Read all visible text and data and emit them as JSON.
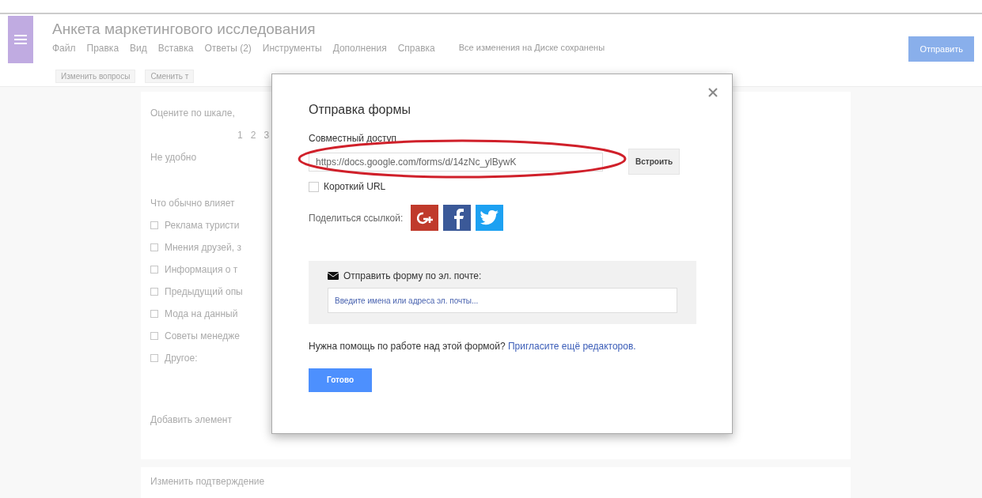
{
  "app": {
    "title": "Анкета маркетингового исследования",
    "menu": [
      "Файл",
      "Правка",
      "Вид",
      "Вставка",
      "Ответы (2)",
      "Инструменты",
      "Дополнения",
      "Справка"
    ],
    "save_status": "Все изменения на Диске сохранены",
    "send_button": "Отправить",
    "toolbar": [
      "Изменить вопросы",
      "Сменить т"
    ]
  },
  "form": {
    "scale_question": "Оцените по шкале,",
    "scale_numbers": [
      "1",
      "2",
      "3"
    ],
    "scale_low": "Не удобно",
    "question": "Что обычно влияет",
    "options": [
      {
        "label": "Реклама туристи",
        "checked": false
      },
      {
        "label": "Мнения друзей, з",
        "checked": false
      },
      {
        "label": "Информация о т",
        "checked": false
      },
      {
        "label": "Предыдущий опы",
        "checked": false
      },
      {
        "label": "Мода на данный",
        "checked": false
      },
      {
        "label": "Советы менедже",
        "checked": false
      },
      {
        "label": "Другое:",
        "checked": false
      }
    ],
    "add_item": "Добавить элемент",
    "confirmation": "Изменить подтверждение"
  },
  "dialog": {
    "title": "Отправка формы",
    "share_label": "Совместный доступ",
    "url": "https://docs.google.com/forms/d/14zNc_ylBywK",
    "embed_button": "Встроить",
    "short_url": {
      "label": "Короткий URL",
      "checked": false
    },
    "share_link_label": "Поделиться ссылкой:",
    "email_label": "Отправить форму по эл. почте:",
    "email_placeholder": "Введите имена или адреса эл. почты...",
    "help_text": "Нужна помощь по работе над этой формой?",
    "help_link": "Пригласите ещё редакторов.",
    "done_button": "Готово"
  }
}
